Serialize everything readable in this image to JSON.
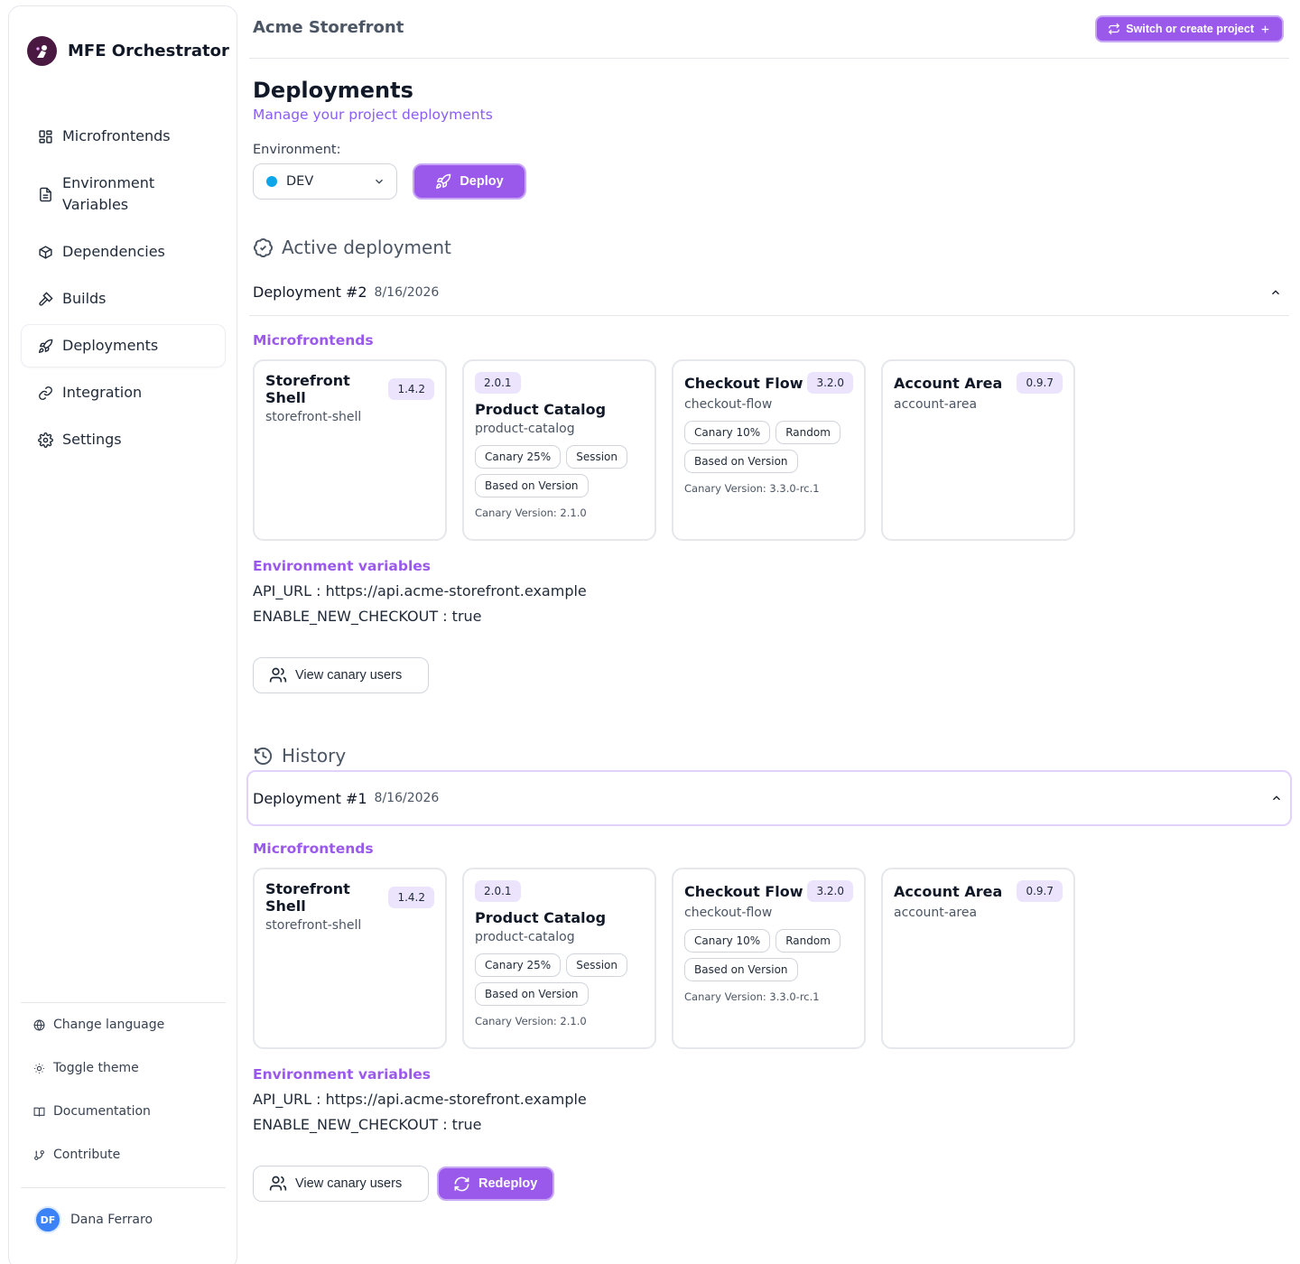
{
  "brand": {
    "name": "MFE Orchestrator"
  },
  "sidebar": {
    "items": [
      {
        "label": "Microfrontends",
        "icon": "grid-icon"
      },
      {
        "label": "Environment Variables",
        "icon": "file-text-icon"
      },
      {
        "label": "Dependencies",
        "icon": "package-icon"
      },
      {
        "label": "Builds",
        "icon": "hammer-icon"
      },
      {
        "label": "Deployments",
        "icon": "rocket-icon",
        "active": true
      },
      {
        "label": "Integration",
        "icon": "link-icon"
      },
      {
        "label": "Settings",
        "icon": "gear-icon"
      }
    ],
    "bottom": [
      {
        "label": "Change language",
        "icon": "globe-icon"
      },
      {
        "label": "Toggle theme",
        "icon": "sun-icon"
      },
      {
        "label": "Documentation",
        "icon": "book-icon"
      },
      {
        "label": "Contribute",
        "icon": "git-branch-icon"
      }
    ],
    "user": {
      "initials": "DF",
      "name": "Dana Ferraro"
    }
  },
  "header": {
    "project": "Acme Storefront",
    "switch_label": "Switch or create project"
  },
  "page": {
    "title": "Deployments",
    "subtitle": "Manage your project deployments",
    "env_label": "Environment:",
    "env_value": "DEV",
    "deploy_label": "Deploy",
    "active_heading": "Active deployment",
    "history_heading": "History",
    "microfrontends_label": "Microfrontends",
    "envvars_label": "Environment variables",
    "view_canary_label": "View canary users",
    "redeploy_label": "Redeploy"
  },
  "active_deployment": {
    "title": "Deployment #2",
    "date": "8/16/2026",
    "mfes": [
      {
        "name": "Storefront Shell",
        "version": "1.4.2",
        "slug": "storefront-shell"
      },
      {
        "name": "Product Catalog",
        "version": "2.0.1",
        "slug": "product-catalog",
        "tags": [
          "Canary 25%",
          "Session",
          "Based on Version"
        ],
        "canary": "Canary Version: 2.1.0"
      },
      {
        "name": "Checkout Flow",
        "version": "3.2.0",
        "slug": "checkout-flow",
        "tags": [
          "Canary 10%",
          "Random",
          "Based on Version"
        ],
        "canary": "Canary Version: 3.3.0-rc.1"
      },
      {
        "name": "Account Area",
        "version": "0.9.7",
        "slug": "account-area"
      }
    ],
    "envvars": [
      {
        "key": "API_URL",
        "value": "https://api.acme-storefront.example"
      },
      {
        "key": "ENABLE_NEW_CHECKOUT",
        "value": "true"
      }
    ]
  },
  "history_deployment": {
    "title": "Deployment #1",
    "date": "8/16/2026",
    "mfes": [
      {
        "name": "Storefront Shell",
        "version": "1.4.2",
        "slug": "storefront-shell"
      },
      {
        "name": "Product Catalog",
        "version": "2.0.1",
        "slug": "product-catalog",
        "tags": [
          "Canary 25%",
          "Session",
          "Based on Version"
        ],
        "canary": "Canary Version: 2.1.0"
      },
      {
        "name": "Checkout Flow",
        "version": "3.2.0",
        "slug": "checkout-flow",
        "tags": [
          "Canary 10%",
          "Random",
          "Based on Version"
        ],
        "canary": "Canary Version: 3.3.0-rc.1"
      },
      {
        "name": "Account Area",
        "version": "0.9.7",
        "slug": "account-area"
      }
    ],
    "envvars": [
      {
        "key": "API_URL",
        "value": "https://api.acme-storefront.example"
      },
      {
        "key": "ENABLE_NEW_CHECKOUT",
        "value": "true"
      }
    ]
  },
  "colors": {
    "accent": "#9b59ec",
    "env_dot": "#0ea5e9",
    "avatar": "#3b82f6"
  }
}
